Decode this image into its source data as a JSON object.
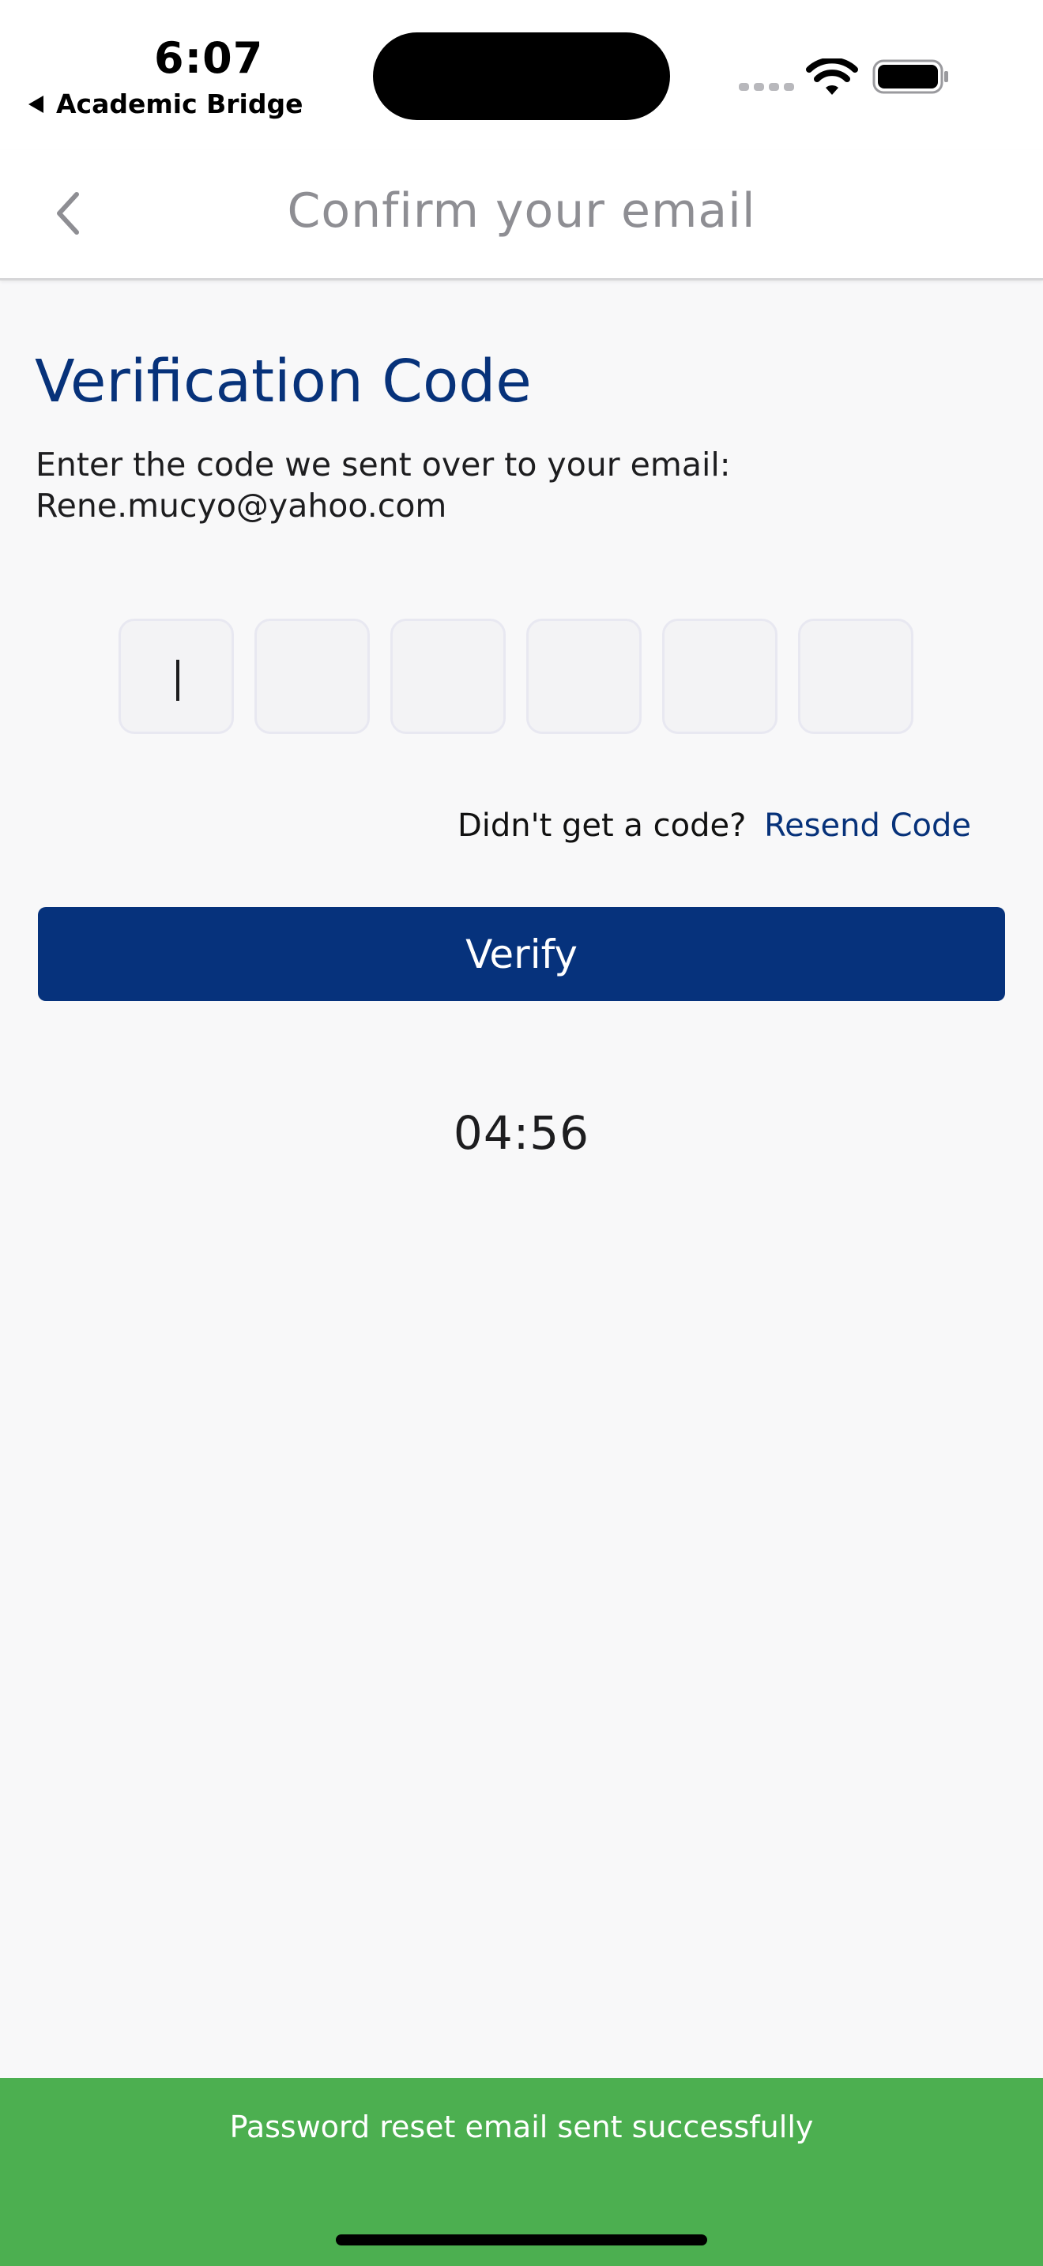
{
  "status_bar": {
    "time": "6:07",
    "back_app_label": "Academic Bridge",
    "icons": [
      "cellular-signal-icon",
      "wifi-icon",
      "battery-icon"
    ]
  },
  "header": {
    "title": "Confirm your email",
    "back_icon": "chevron-left-icon"
  },
  "main": {
    "title": "Verification Code",
    "instruction_line1": "Enter the code we sent over to your email:",
    "email": "Rene.mucyo@yahoo.com",
    "code_digits": [
      "",
      "",
      "",
      "",
      "",
      ""
    ],
    "resend_prompt": "Didn't get a code?",
    "resend_link": "Resend Code",
    "verify_label": "Verify",
    "timer": "04:56"
  },
  "toast": {
    "message": "Password reset email sent successfully"
  },
  "colors": {
    "brand_blue": "#06327c",
    "toast_green": "#4caf50",
    "header_title_gray": "#8e8e93",
    "background": "#f8f8f9"
  }
}
